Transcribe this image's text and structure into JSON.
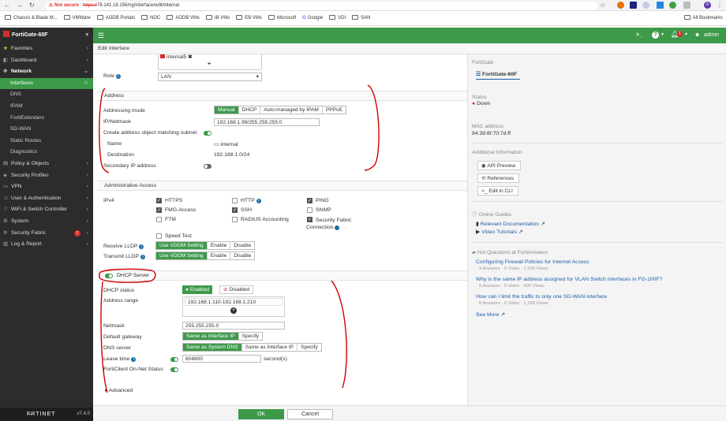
{
  "browser": {
    "not_secure": "Not secure",
    "url_scheme": "https://",
    "url_rest": "78.141.18.156/ng/interface/edit/internal",
    "bookmarks": [
      "Chassis & Blade M...",
      "VMWare",
      "AODB Portals",
      "NOC",
      "AODB VMs",
      "IB VMs",
      "EB VMs",
      "Microsoft",
      "Google",
      "VDI",
      "SAN"
    ],
    "all_bookmarks": "All Bookmarks",
    "avatar_letter": "A"
  },
  "topbar": {
    "device": "FortiGate-60F",
    "cli_glyph": ">_",
    "help_glyph": "?",
    "bell_count": "1",
    "user": "admin"
  },
  "sidebar": {
    "items": [
      {
        "label": "Favorites",
        "icon": "★"
      },
      {
        "label": "Dashboard",
        "icon": "◧"
      },
      {
        "label": "Network",
        "icon": "✥"
      },
      {
        "label": "Interfaces"
      },
      {
        "label": "DNS"
      },
      {
        "label": "IPAM"
      },
      {
        "label": "FortiExtenders"
      },
      {
        "label": "SD-WAN"
      },
      {
        "label": "Static Routes"
      },
      {
        "label": "Diagnostics"
      },
      {
        "label": "Policy & Objects",
        "icon": "▤"
      },
      {
        "label": "Security Profiles",
        "icon": "◈"
      },
      {
        "label": "VPN",
        "icon": "▭"
      },
      {
        "label": "User & Authentication",
        "icon": "☺"
      },
      {
        "label": "WiFi & Switch Controller",
        "icon": "⌔"
      },
      {
        "label": "System",
        "icon": "⚙"
      },
      {
        "label": "Security Fabric",
        "icon": "✲",
        "badge": "1"
      },
      {
        "label": "Log & Report",
        "icon": "▥"
      }
    ],
    "footer_brand": "F̶RTINET",
    "version": "v7.4.0"
  },
  "breadcrumb": "Edit Interface",
  "form": {
    "member_tag": "internal5",
    "plus": "+",
    "role_label": "Role",
    "role_value": "LAN",
    "address_section": "Address",
    "addressing_mode_label": "Addressing mode",
    "addressing_modes": [
      "Manual",
      "DHCP",
      "Auto-managed by IPAM",
      "PPPoE"
    ],
    "ip_label": "IP/Netmask",
    "ip_value": "192.168.1.99/255.255.255.0",
    "create_obj_label": "Create address object matching subnet",
    "name_label": "Name",
    "name_value": "internal",
    "dest_label": "Destination",
    "dest_value": "192.168.1.0/24",
    "secondary_label": "Secondary IP address",
    "admin_section": "Administrative Access",
    "ipv4_label": "IPv4",
    "access": {
      "https": "HTTPS",
      "http": "HTTP",
      "ping": "PING",
      "fmg": "FMG-Access",
      "ssh": "SSH",
      "snmp": "SNMP",
      "ftm": "FTM",
      "radius": "RADIUS Accounting",
      "fabric": "Security Fabric Connection",
      "speed": "Speed Test"
    },
    "rx_lldp_label": "Receive LLDP",
    "tx_lldp_label": "Transmit LLDP",
    "lldp_opts": [
      "Use VDOM Setting",
      "Enable",
      "Disable"
    ],
    "dhcp_section": "DHCP Server",
    "dhcp_status_label": "DHCP status",
    "dhcp_enabled": "Enabled",
    "dhcp_disabled": "Disabled",
    "range_label": "Address range",
    "range_value": "192.168.1.110-192.168.1.210",
    "netmask_label": "Netmask",
    "netmask_value": "255.255.255.0",
    "gw_label": "Default gateway",
    "gw_opts": [
      "Same as Interface IP",
      "Specify"
    ],
    "dns_label": "DNS server",
    "dns_opts": [
      "Same as System DNS",
      "Same as Interface IP",
      "Specify"
    ],
    "lease_label": "Lease time",
    "lease_value": "604800",
    "lease_unit": "second(s)",
    "forticlient_label": "FortiClient On-Net Status",
    "advanced_label": "Advanced"
  },
  "panel": {
    "fg_head": "FortiGate",
    "fg_name": "FortiGate-60F",
    "status_head": "Status",
    "status_value": "Down",
    "mac_head": "MAC address",
    "mac_value": "84:39:8f:70:7d:ff",
    "addl_head": "Additional Information",
    "btn_api": "API Preview",
    "btn_refs": "References",
    "btn_cli": "Edit in CLI",
    "guides_head": "Online Guides",
    "doc_link": "Relevant Documentation",
    "video_link": "Video Tutorials",
    "hot_head": "Hot Questions at FortiAnswers",
    "questions": [
      {
        "title": "Configuring Firewall Policies for Internet Access",
        "answers": "4 Answers",
        "votes": "0 Votes",
        "views": "1,599 Views"
      },
      {
        "title": "Why is the same IP address assigned for VLAN Switch interfaces in FG-100F?",
        "answers": "6 Answers",
        "votes": "0 Votes",
        "views": "500 Views"
      },
      {
        "title": "How can I limit the traffic to only one SD-WAN interface",
        "answers": "8 Answers",
        "votes": "0 Votes",
        "views": "1,199 Views"
      }
    ],
    "see_more": "See More"
  },
  "buttons": {
    "ok": "OK",
    "cancel": "Cancel"
  },
  "colors": {
    "brand_green": "#3d9a4a",
    "sidebar_bg": "#2c2c2c",
    "annotation_red": "#d00000",
    "status_down": "#d32f2f",
    "link": "#1c5ea8"
  }
}
